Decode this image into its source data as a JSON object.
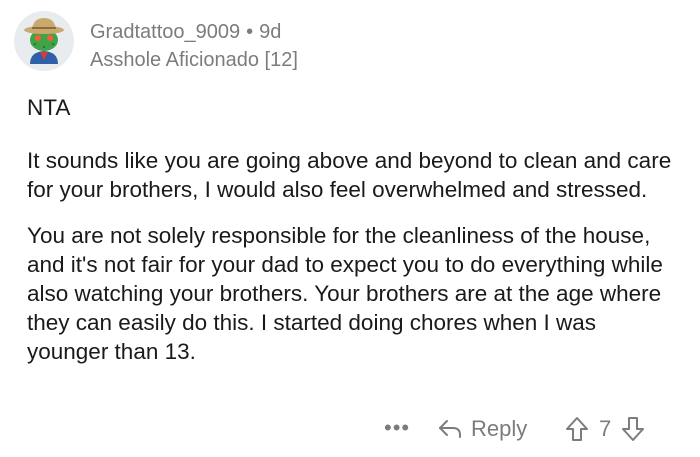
{
  "comment": {
    "author": "Gradtattoo_9009",
    "separator": "•",
    "age": "9d",
    "flair": "Asshole Aficionado [12]",
    "paragraphs": [
      "NTA",
      "It sounds like you are going above and beyond to clean and care for your brothers, I would also feel overwhelmed and stressed.",
      "You are not solely responsible for the cleanliness of the house, and it's not fair for your dad to expect you to do everything while also watching your brothers. Your brothers are at the age where they can easily do this. I started doing chores when I was younger than 13."
    ]
  },
  "actions": {
    "more": "•••",
    "reply_label": "Reply",
    "score": "7"
  },
  "icons": {
    "avatar": "snoo-avatar-icon",
    "more": "more-options-icon",
    "reply": "reply-arrow-icon",
    "upvote": "upvote-arrow-icon",
    "downvote": "downvote-arrow-icon"
  },
  "colors": {
    "meta_text": "#7c7c7c",
    "body_text": "#1a1a1b",
    "avatar_bg": "#e9ecef",
    "avatar_green": "#3fa447",
    "hat_tan": "#c9a96e"
  }
}
